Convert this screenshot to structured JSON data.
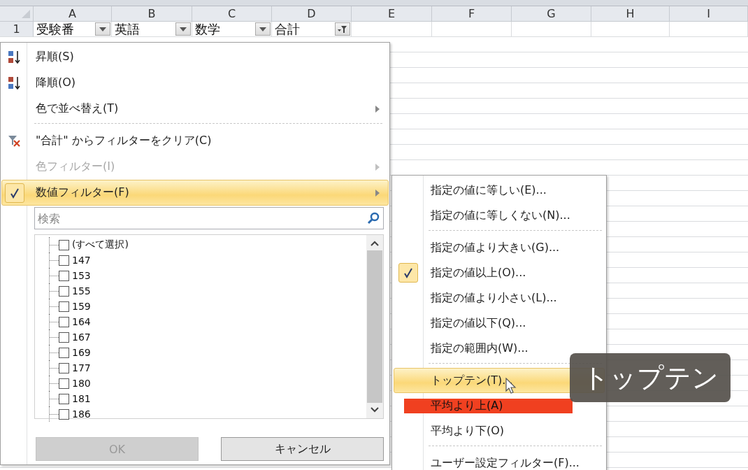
{
  "sheet": {
    "columns": [
      "A",
      "B",
      "C",
      "D",
      "E",
      "F",
      "G",
      "H",
      "I"
    ],
    "rows": [
      {
        "number": "1",
        "cells": [
          {
            "text": "受験番",
            "filtered": false
          },
          {
            "text": "英語",
            "filtered": false
          },
          {
            "text": "数学",
            "filtered": false
          },
          {
            "text": "合計",
            "filtered": true
          }
        ]
      }
    ]
  },
  "filter_menu": {
    "items": [
      {
        "kind": "sort-ascending",
        "label": "昇順(S)",
        "disabled": false,
        "selected": false,
        "checked": false
      },
      {
        "kind": "sort-descending",
        "label": "降順(O)",
        "disabled": false,
        "selected": false,
        "checked": false
      },
      {
        "kind": "submenu",
        "label": "色で並べ替え(T)",
        "disabled": false,
        "selected": false,
        "checked": false
      },
      {
        "kind": "separator"
      },
      {
        "kind": "clear-filter",
        "label": "\"合計\" からフィルターをクリア(C)",
        "disabled": false,
        "selected": false,
        "checked": false
      },
      {
        "kind": "submenu",
        "label": "色フィルター(I)",
        "disabled": true,
        "selected": false,
        "checked": false
      },
      {
        "kind": "submenu",
        "label": "数値フィルター(F)",
        "disabled": false,
        "selected": true,
        "checked": true
      }
    ],
    "search": {
      "placeholder": "検索"
    },
    "values": [
      {
        "label": "(すべて選択)",
        "checked": false
      },
      {
        "label": "147",
        "checked": false
      },
      {
        "label": "153",
        "checked": false
      },
      {
        "label": "155",
        "checked": false
      },
      {
        "label": "159",
        "checked": false
      },
      {
        "label": "164",
        "checked": false
      },
      {
        "label": "167",
        "checked": false
      },
      {
        "label": "169",
        "checked": false
      },
      {
        "label": "177",
        "checked": false
      },
      {
        "label": "180",
        "checked": false
      },
      {
        "label": "181",
        "checked": false
      },
      {
        "label": "186",
        "checked": false
      }
    ],
    "buttons": [
      {
        "label": "OK",
        "disabled": true
      },
      {
        "label": "キャンセル",
        "disabled": false
      }
    ]
  },
  "number_filter_menu": {
    "items": [
      {
        "kind": "item",
        "label": "指定の値に等しい(E)...",
        "selected": false,
        "checked": false
      },
      {
        "kind": "item",
        "label": "指定の値に等しくない(N)...",
        "selected": false,
        "checked": false
      },
      {
        "kind": "separator"
      },
      {
        "kind": "item",
        "label": "指定の値より大きい(G)...",
        "selected": false,
        "checked": false
      },
      {
        "kind": "item",
        "label": "指定の値以上(O)...",
        "selected": false,
        "checked": true
      },
      {
        "kind": "item",
        "label": "指定の値より小さい(L)...",
        "selected": false,
        "checked": false
      },
      {
        "kind": "item",
        "label": "指定の値以下(Q)...",
        "selected": false,
        "checked": false
      },
      {
        "kind": "item",
        "label": "指定の範囲内(W)...",
        "selected": false,
        "checked": false
      },
      {
        "kind": "separator"
      },
      {
        "kind": "item",
        "label": "トップテン(T)...",
        "selected": true,
        "checked": false
      },
      {
        "kind": "item",
        "label": "平均より上(A)",
        "selected": false,
        "checked": false,
        "marked": true
      },
      {
        "kind": "item",
        "label": "平均より下(O)",
        "selected": false,
        "checked": false
      },
      {
        "kind": "separator"
      },
      {
        "kind": "item",
        "label": "ユーザー設定フィルター(F)...",
        "selected": false,
        "checked": false
      }
    ]
  },
  "caption": "トップテン"
}
